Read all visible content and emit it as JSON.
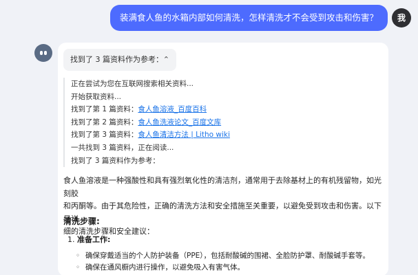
{
  "user": {
    "message": "装满食人鱼的水箱内部如何清洗，怎样清洗才不会受到攻击和伤害？",
    "avatar_label": "我"
  },
  "assistant": {
    "toggle_label": "找到了 3 篇资料作为参考：",
    "search_log": {
      "line1": "正在尝试为您在互联网搜索相关资料...",
      "line2": "开始获取资料...",
      "ref1_prefix": "找到了第 1 篇资料：",
      "ref1_link": "食人鱼溶液_百度百科",
      "ref2_prefix": "找到了第 2 篇资料：",
      "ref2_link": "食人鱼洗液论文_百度文库",
      "ref3_prefix": "找到了第 3 篇资料：",
      "ref3_link": "食人鱼清洁方法 | Litho wiki",
      "line6": "一共找到 3 篇资料，正在阅读...",
      "line7": "找到了 3 篇资料作为参考："
    },
    "answer_line1": "食人鱼溶液是一种强酸性和具有强烈氧化性的清洁剂，通常用于去除基材上的有机残留物，如光刻胶",
    "answer_line2": "和丙酮等。由于其危险性，正确的清洗方法和安全措施至关重要，以避免受到攻击和伤害。以下是详",
    "answer_line3": "细的清洗步骤和安全建议：",
    "steps_heading": "清洗步骤:",
    "step1_number": "1.",
    "step1_title": "准备工作:",
    "bullets": {
      "b1": "确保穿戴适当的个人防护装备（PPE），包括耐酸碱的围裙、全脸防护罩、耐酸碱手套等。",
      "b2": "确保在通风橱内进行操作，以避免吸入有害气体。"
    }
  },
  "colors": {
    "user_bubble": "#4d6bfe",
    "link": "#1a73e8",
    "background": "#f0f2f7"
  },
  "icons": {
    "bot_avatar": "robot-face-icon",
    "toggle": "chevron-up-icon"
  }
}
